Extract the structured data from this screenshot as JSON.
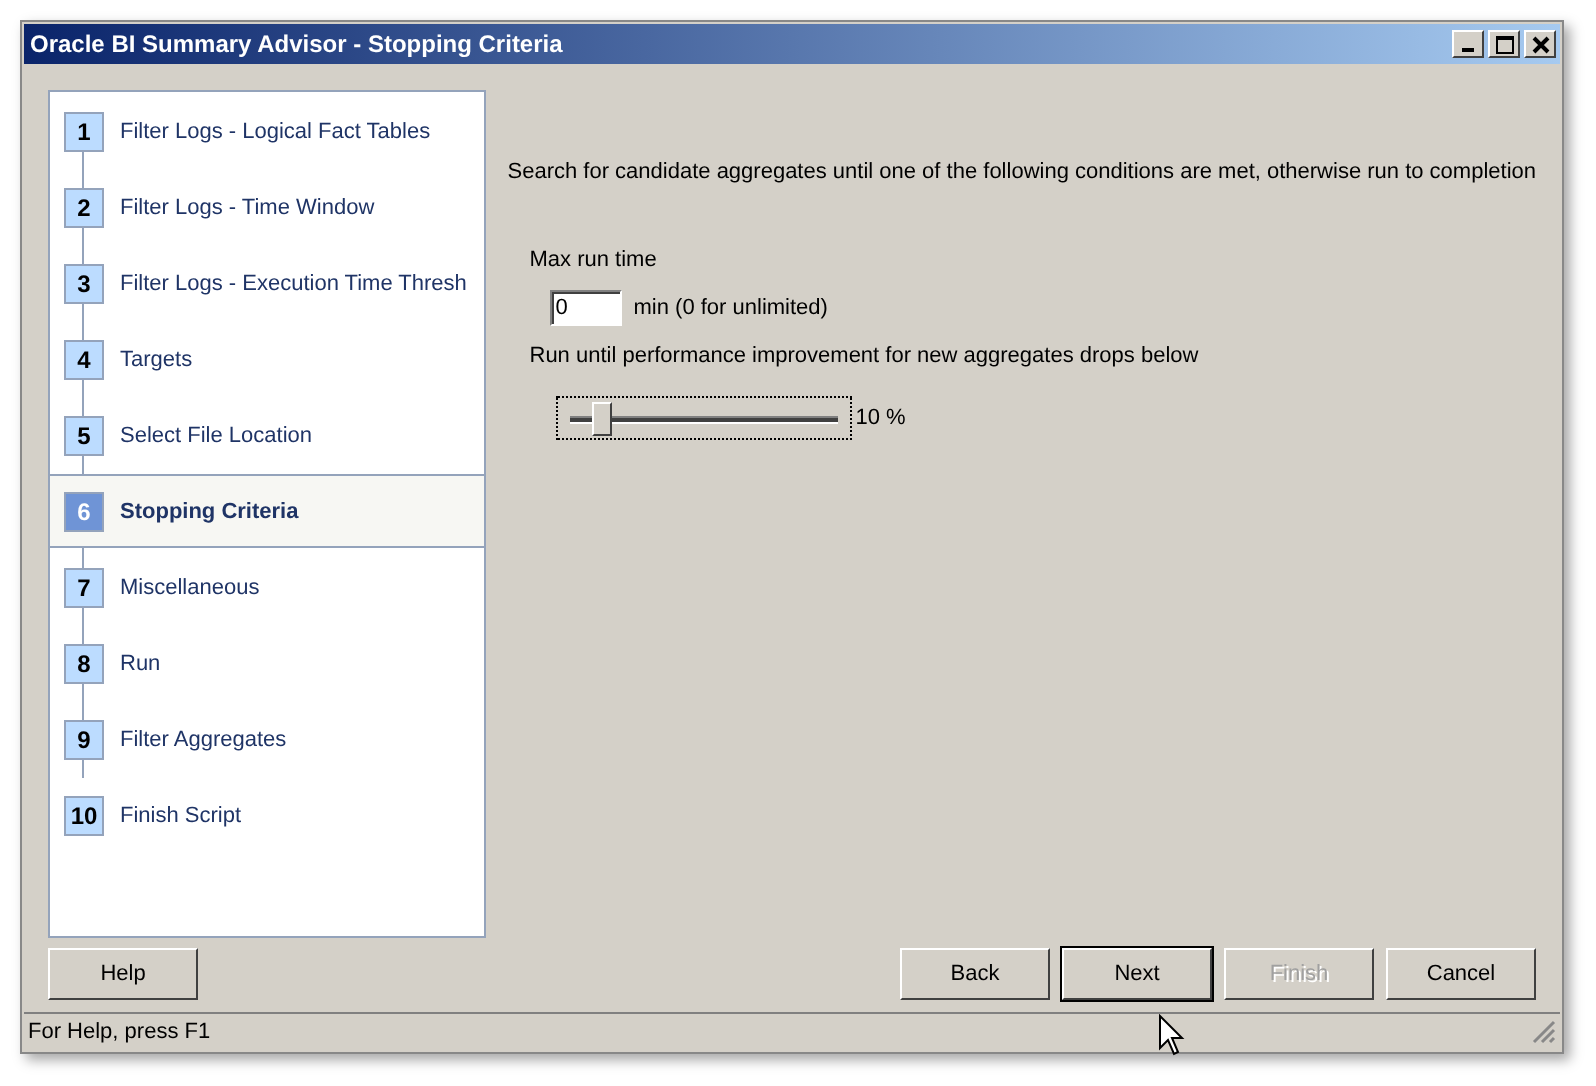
{
  "window": {
    "title": "Oracle BI Summary Advisor - Stopping Criteria"
  },
  "steps": [
    {
      "number": "1",
      "label": "Filter Logs - Logical Fact Tables",
      "selected": false
    },
    {
      "number": "2",
      "label": "Filter Logs - Time Window",
      "selected": false
    },
    {
      "number": "3",
      "label": "Filter Logs - Execution Time Thresh",
      "selected": false
    },
    {
      "number": "4",
      "label": "Targets",
      "selected": false
    },
    {
      "number": "5",
      "label": "Select File Location",
      "selected": false
    },
    {
      "number": "6",
      "label": "Stopping Criteria",
      "selected": true
    },
    {
      "number": "7",
      "label": "Miscellaneous",
      "selected": false
    },
    {
      "number": "8",
      "label": "Run",
      "selected": false
    },
    {
      "number": "9",
      "label": "Filter Aggregates",
      "selected": false
    },
    {
      "number": "10",
      "label": "Finish Script",
      "selected": false
    }
  ],
  "intro": "Search for candidate aggregates until one of the following conditions are met, otherwise run to completion",
  "max_run_time": {
    "label": "Max run time",
    "value": "0",
    "unit": "min  (0 for unlimited)"
  },
  "improvement": {
    "label": "Run until performance improvement for new aggregates drops below",
    "level": 0.12,
    "reading": "10 %"
  },
  "buttons": [
    {
      "label": "Help",
      "disabled": false,
      "default": false
    },
    {
      "label": "Back",
      "disabled": false,
      "default": false
    },
    {
      "label": "Next",
      "disabled": false,
      "default": true
    },
    {
      "label": "Finish",
      "disabled": true,
      "default": false
    },
    {
      "label": "Cancel",
      "disabled": false,
      "default": false
    }
  ],
  "status_bar": "For Help, press F1"
}
